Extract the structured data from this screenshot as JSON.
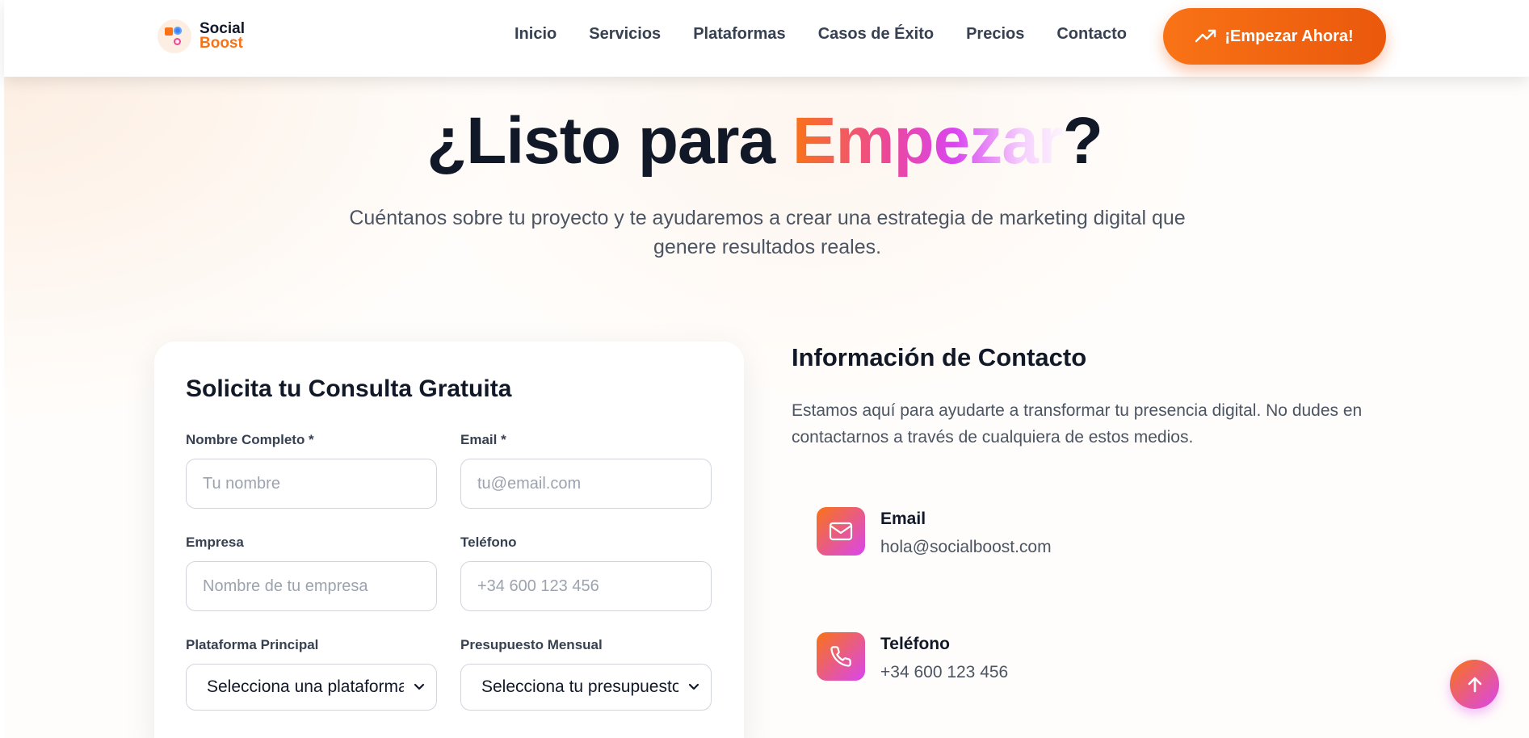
{
  "brand": {
    "line1": "Social",
    "line2": "Boost"
  },
  "nav": {
    "items": [
      "Inicio",
      "Servicios",
      "Plataformas",
      "Casos de Éxito",
      "Precios",
      "Contacto"
    ],
    "cta_label": "¡Empezar Ahora!",
    "cta_icon": "trending-up-icon"
  },
  "hero": {
    "title_prefix": "¿Listo para ",
    "title_highlight": "Empezar",
    "title_suffix": "?",
    "subtitle": "Cuéntanos sobre tu proyecto y te ayudaremos a crear una estrategia de marketing digital que genere resultados reales."
  },
  "form": {
    "title": "Solicita tu Consulta Gratuita",
    "name": {
      "label": "Nombre Completo *",
      "placeholder": "Tu nombre"
    },
    "email": {
      "label": "Email *",
      "placeholder": "tu@email.com"
    },
    "company": {
      "label": "Empresa",
      "placeholder": "Nombre de tu empresa"
    },
    "phone": {
      "label": "Teléfono",
      "placeholder": "+34 600 123 456"
    },
    "platform": {
      "label": "Plataforma Principal",
      "selected": "Selecciona una plataforma"
    },
    "budget": {
      "label": "Presupuesto Mensual",
      "selected": "Selecciona tu presupuesto"
    }
  },
  "contact": {
    "title": "Información de Contacto",
    "text": "Estamos aquí para ayudarte a transformar tu presencia digital. No dudes en contactarnos a través de cualquiera de estos medios.",
    "items": [
      {
        "label": "Email",
        "value": "hola@socialboost.com",
        "icon": "mail-icon"
      },
      {
        "label": "Teléfono",
        "value": "+34 600 123 456",
        "icon": "phone-icon"
      }
    ]
  },
  "colors": {
    "accent": "#f97316",
    "accent_pink": "#d946ef",
    "text_dark": "#111827",
    "text_muted": "#4b5563"
  }
}
